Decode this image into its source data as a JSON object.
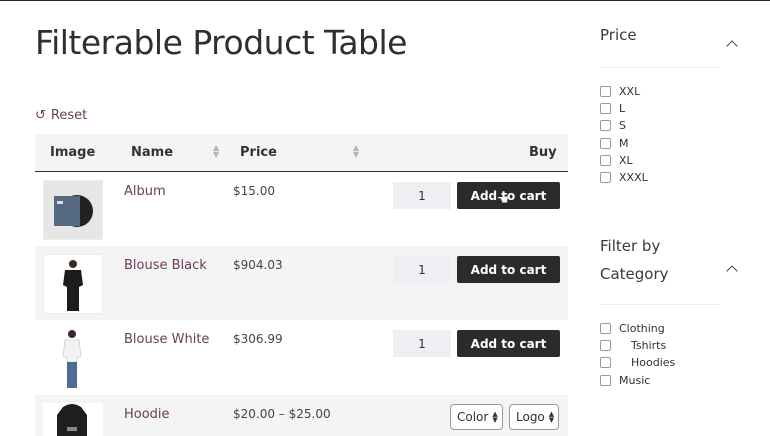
{
  "page": {
    "title": "Filterable Product Table",
    "reset_label": "Reset"
  },
  "table": {
    "headers": {
      "image": "Image",
      "name": "Name",
      "price": "Price",
      "buy": "Buy"
    },
    "rows": [
      {
        "name": "Album",
        "price": "$15.00",
        "qty": "1",
        "button": "Add to cart"
      },
      {
        "name": "Blouse Black",
        "price": "$904.03",
        "qty": "1",
        "button": "Add to cart"
      },
      {
        "name": "Blouse White",
        "price": "$306.99",
        "qty": "1",
        "button": "Add to cart"
      },
      {
        "name": "Hoodie",
        "price": "$20.00 – $25.00",
        "select1": "Color",
        "select2": "Logo"
      }
    ]
  },
  "sidebar": {
    "price_title": "Price",
    "sizes": [
      "XXL",
      "L",
      "S",
      "M",
      "XL",
      "XXXL"
    ],
    "category_title_line1": "Filter by",
    "category_title_line2": "Category",
    "categories": [
      "Clothing",
      "Tshirts",
      "Hoodies",
      "Music"
    ]
  },
  "colors": {
    "link": "#6b3d5a",
    "button_bg": "#2b2b2b",
    "stripe": "#f4f4f4"
  }
}
